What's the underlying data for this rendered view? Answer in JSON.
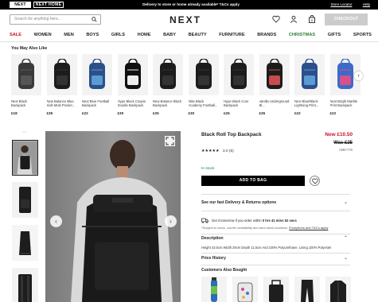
{
  "topbar": {
    "brand_next": "NEXT",
    "brand_home": "NEXT HOME",
    "promo": "Delivery to store or home already available* T&Cs apply",
    "store_locator": "Store Locator",
    "help": "Help"
  },
  "header": {
    "search_placeholder": "Search for anything here...",
    "logo": "NEXT",
    "bag_count": "0",
    "checkout_label": "CHECKOUT"
  },
  "nav": [
    "SALE",
    "WOMEN",
    "MEN",
    "BOYS",
    "GIRLS",
    "HOME",
    "BABY",
    "BEAUTY",
    "FURNITURE",
    "BRANDS",
    "CHRISTMAS",
    "GIFTS",
    "SPORTS"
  ],
  "recommend": {
    "title": "You May Also Like",
    "items": [
      {
        "name": "Next Black Backpack",
        "price": "£18",
        "icon": "backpack-grey-icon"
      },
      {
        "name": "New Balance Blue Kids Multi Pocket...",
        "price": "£35",
        "icon": "backpack-black-icon"
      },
      {
        "name": "Next Blue Football Backpack",
        "price": "£22",
        "icon": "backpack-blue-icon"
      },
      {
        "name": "Hype Black Crayon Doodle Backpack",
        "price": "£30",
        "icon": "backpack-doodle-icon"
      },
      {
        "name": "New Balance Black Backpack",
        "price": "£25",
        "icon": "backpack-black-icon"
      },
      {
        "name": "Nike Black Academy Football...",
        "price": "£30",
        "icon": "backpack-black-icon"
      },
      {
        "name": "Hype Black Core Backpack",
        "price": "£25",
        "icon": "backpack-black-icon"
      },
      {
        "name": "Vanilla Underground Bl...",
        "price": "£35",
        "icon": "backpack-print-icon"
      },
      {
        "name": "Next Blue/Black Lightning Print...",
        "price": "£22",
        "icon": "backpack-blue-icon"
      },
      {
        "name": "Next Bright Marble Print Backpack",
        "price": "£22",
        "icon": "backpack-marble-icon"
      }
    ]
  },
  "product": {
    "title": "Black Roll Top Backpack",
    "now_price": "Now £10.50",
    "was_price": "Was £25",
    "code": "AM9-770",
    "stars": "★★★★★",
    "rating": "3.0 (5)",
    "stock": "In stock",
    "add_to_bag": "ADD TO BAG",
    "delivery_heading": "See our fast Delivery & Returns options",
    "delivery_pre": "Get it tomorrow if you order within ",
    "delivery_time": "0 hrs 41 mins 52 secs",
    "delivery_note": "*Subject to stock, courier availability and area stock locations.",
    "delivery_link": "Exceptions and T&Cs apply",
    "description_heading": "Description",
    "description_text": "Height 43.5cm Width 29cm Depth 11.5cm And 100% Polyurethane. Lining 100% Polyester",
    "price_history": "Price History",
    "also_bought": "Customers Also Bought"
  }
}
